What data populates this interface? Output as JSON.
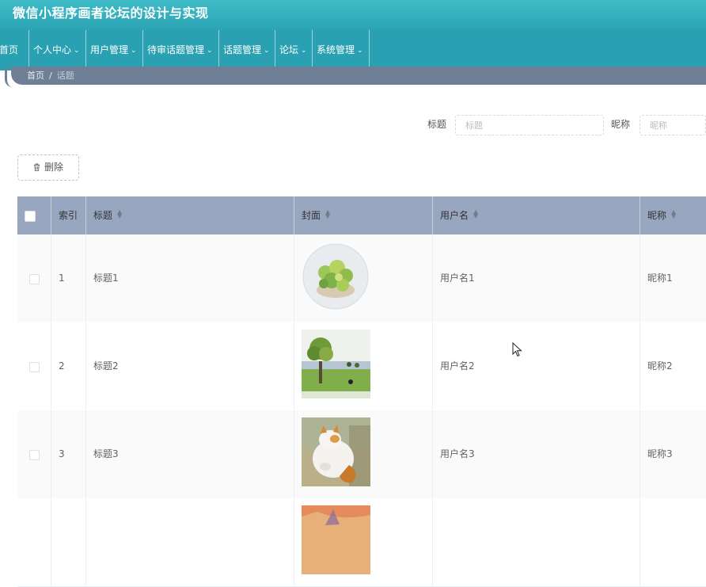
{
  "app": {
    "title": "微信小程序画者论坛的设计与实现"
  },
  "nav": {
    "items": [
      {
        "label": "首页",
        "has_dropdown": false
      },
      {
        "label": "个人中心",
        "has_dropdown": true
      },
      {
        "label": "用户管理",
        "has_dropdown": true
      },
      {
        "label": "待审话题管理",
        "has_dropdown": true
      },
      {
        "label": "话题管理",
        "has_dropdown": true
      },
      {
        "label": "论坛",
        "has_dropdown": true
      },
      {
        "label": "系统管理",
        "has_dropdown": true
      }
    ],
    "dropdown_icon": "chevron-down-icon"
  },
  "breadcrumb": {
    "home": "首页",
    "separator": "/",
    "current": "话题"
  },
  "search": {
    "title_label": "标题",
    "title_placeholder": "标题",
    "nickname_label": "昵称",
    "nickname_placeholder": "昵称"
  },
  "toolbar": {
    "delete_label": "删除",
    "delete_icon": "trash-icon"
  },
  "table": {
    "columns": [
      "索引",
      "标题",
      "封面",
      "用户名",
      "昵称"
    ],
    "sortable_icon": "sort-caret-icon",
    "rows": [
      {
        "index": "1",
        "title": "标题1",
        "cover": "watercolor-plant-round",
        "username": "用户名1",
        "nickname": "昵称1"
      },
      {
        "index": "2",
        "title": "标题2",
        "cover": "watercolor-tree-landscape",
        "username": "用户名2",
        "nickname": "昵称2"
      },
      {
        "index": "3",
        "title": "标题3",
        "cover": "watercolor-cat",
        "username": "用户名3",
        "nickname": "昵称3"
      },
      {
        "index": "",
        "title": "",
        "cover": "watercolor-partial",
        "username": "",
        "nickname": ""
      }
    ]
  },
  "colors": {
    "header": "#2ba4b3",
    "nav": "#2aa1b2",
    "table_header": "#98a6bf",
    "breadcrumb": "#6f7f95"
  }
}
